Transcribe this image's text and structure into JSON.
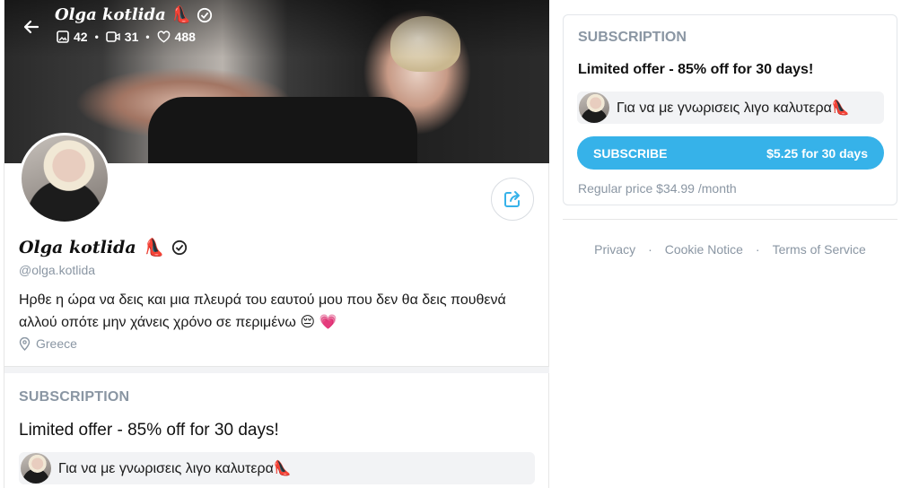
{
  "profile": {
    "name": "𝑶𝒍𝒈𝒂 𝒌𝒐𝒕𝒍𝒊𝒅𝒂",
    "name_emoji": "👠",
    "handle": "@olga.kotlida",
    "bio": "Ηρθε η ώρα να δεις και μια πλευρά του εαυτού μου που δεν θα δεις πουθενά αλλού οπότε μην χάνεις χρόνο σε περιμένω 😔 💗",
    "location": "Greece",
    "stats": {
      "photos": "42",
      "videos": "31",
      "likes": "488"
    }
  },
  "subscription": {
    "title": "SUBSCRIPTION",
    "offer": "Limited offer - 85% off for 30 days!",
    "message": "Για να με γνωρισεις λιγο καλυτερα👠",
    "button_label": "SUBSCRIBE",
    "button_price": "$5.25 for 30 days",
    "regular_price": "Regular price $34.99 /month"
  },
  "footer": {
    "links": [
      "Privacy",
      "Cookie Notice",
      "Terms of Service"
    ],
    "separator": "·"
  },
  "colors": {
    "accent": "#36b2e9",
    "muted_text": "#8a96a3",
    "message_bg": "#f2f3f5"
  },
  "icons": {
    "back": "arrow-left-icon",
    "photos": "image-icon",
    "videos": "video-icon",
    "likes": "heart-icon",
    "verified": "verified-badge-icon",
    "share": "share-icon",
    "location": "location-pin-icon"
  }
}
